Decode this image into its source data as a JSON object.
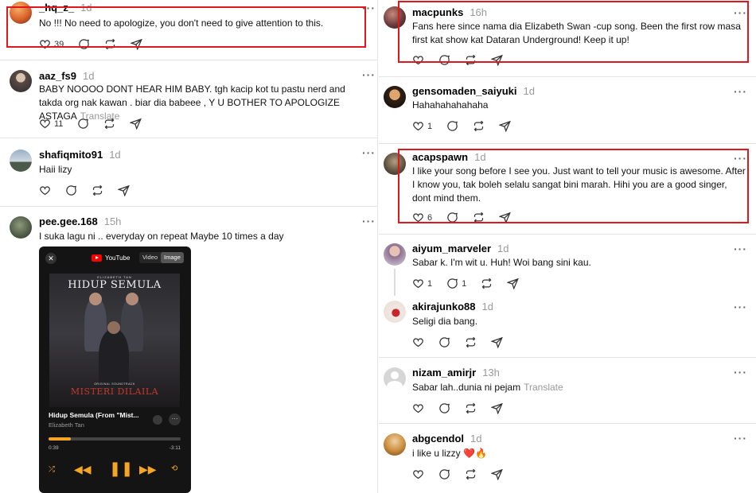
{
  "left_posts": [
    {
      "username": "_hq_z_",
      "time": "1d",
      "text": "No !!! No need to apologize, you don't need to give attention to this.",
      "translate": "",
      "likes": "39",
      "replies": ""
    },
    {
      "username": "aaz_fs9",
      "time": "1d",
      "text": "BABY NOOOO DONT HEAR HIM BABY. tgh kacip kot tu pastu nerd and takda org nak kawan . biar dia babeee , Y U BOTHER TO APOLOGIZE ASTAGA",
      "translate": "Translate",
      "likes": "11",
      "replies": ""
    },
    {
      "username": "shafiqmito91",
      "time": "1d",
      "text": "Haii lizy",
      "translate": "",
      "likes": "",
      "replies": ""
    },
    {
      "username": "pee.gee.168",
      "time": "15h",
      "text": "I suka lagu ni .. everyday on repeat Maybe 10 times a day",
      "translate": "",
      "likes": "",
      "replies": ""
    }
  ],
  "right_posts": [
    {
      "username": "macpunks",
      "time": "16h",
      "text": "Fans here since nama dia Elizabeth Swan -cup song. Been the first row masa first kat show kat Dataran Underground! Keep it up!",
      "translate": "",
      "likes": "",
      "replies": ""
    },
    {
      "username": "gensomaden_saiyuki",
      "time": "1d",
      "text": "Hahahahahahaha",
      "translate": "",
      "likes": "1",
      "replies": ""
    },
    {
      "username": "acapspawn",
      "time": "1d",
      "text": "I like your song before I see you. Just want to tell your music is awesome. After I know you, tak boleh selalu sangat bini marah. Hihi you are a good singer, dont mind them.",
      "translate": "",
      "likes": "6",
      "replies": ""
    },
    {
      "username": "aiyum_marveler",
      "time": "1d",
      "text": "Sabar k. I'm wit u. Huh! Woi bang sini kau.",
      "translate": "",
      "likes": "1",
      "replies": "1"
    },
    {
      "username": "akirajunko88",
      "time": "1d",
      "text": "Seligi dia bang.",
      "translate": "",
      "likes": "",
      "replies": ""
    },
    {
      "username": "nizam_amirjr",
      "time": "13h",
      "text": "Sabar lah..dunia ni pejam",
      "translate": "Translate",
      "likes": "",
      "replies": ""
    },
    {
      "username": "abgcendol",
      "time": "1d",
      "text": "i like u lizzy ❤️🔥",
      "translate": "",
      "likes": "",
      "replies": ""
    }
  ],
  "music_card": {
    "source": "YouTube",
    "tab_video": "Video",
    "tab_image": "Image",
    "art_small": "ELIZABETH TAN",
    "art_title_top": "HIDUP SEMULA",
    "art_ost": "ORIGINAL SOUNDTRACK",
    "art_title_bottom": "MISTERI DILAILA",
    "song": "Hidup Semula (From \"Mist...",
    "artist": "Elizabeth Tan",
    "elapsed": "0:39",
    "remaining": "-3:11",
    "progress_fraction": 0.17
  },
  "dots": "···",
  "colors": {
    "highlight": "#e0181e",
    "accent": "#f5a623"
  }
}
